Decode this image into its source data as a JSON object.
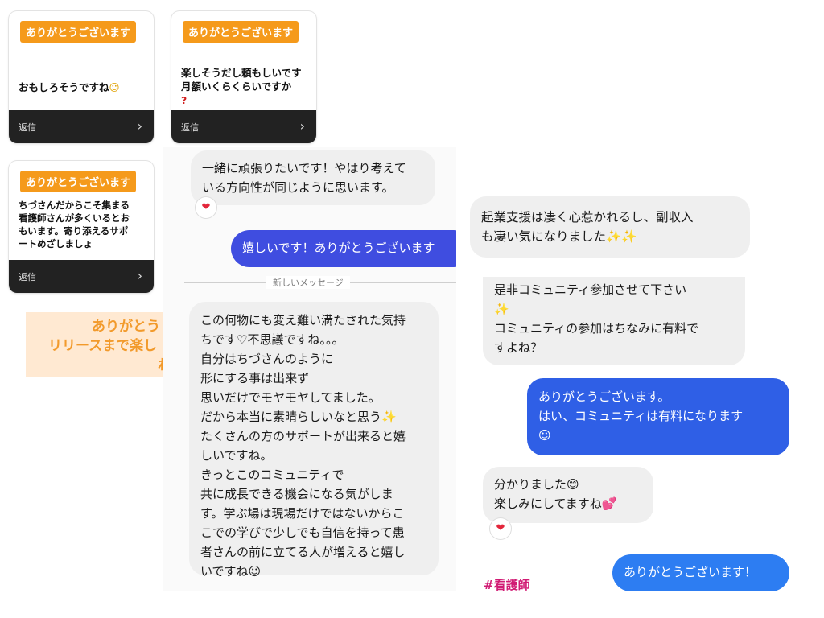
{
  "cards": [
    {
      "tag": "ありがとうございます",
      "lines": [
        "おもしろそうですね"
      ],
      "emoji": "☺",
      "reply_label": "返信"
    },
    {
      "tag": "ありがとうございます",
      "lines": [
        "楽しそうだし頼もしいです",
        "月額いくらくらいですか"
      ],
      "emoji": "?",
      "reply_label": "返信"
    },
    {
      "tag": "ありがとうございます",
      "lines": [
        "ちづさんだからこそ集まる",
        "看護師さんが多くいるとお",
        "もいます。寄り添えるサポ",
        "ートめざしましょ"
      ],
      "reply_label": "返信"
    }
  ],
  "banner": {
    "lines": [
      "ありがとう",
      "リリースまで楽し",
      "れ"
    ]
  },
  "chat_left": {
    "msg1": [
      "一緒に頑張りたいです！やはり考えて",
      "いる方向性が同じように思います。"
    ],
    "reaction": "❤",
    "msg2": "嬉しいです！ありがとうございます",
    "new_messages_label": "新しいメッセージ",
    "msg3": [
      "この何物にも変え難い満たされた気持",
      "ちです♡不思議ですね。。。",
      "自分はちづさんのように",
      "形にする事は出来ず",
      "思いだけでモヤモヤしてました。",
      "だから本当に素晴らしいなと思う✨",
      "たくさんの方のサポートが出来ると嬉",
      "しいですね。",
      "きっとこのコミュニティで",
      "共に成長できる機会になる気がしま",
      "す。学ぶ場は現場だけではないからこ",
      "こでの学びで少しでも自信を持って患",
      "者さんの前に立てる人が増えると嬉し",
      "いですね☺"
    ]
  },
  "chat_right_top": {
    "msg": [
      "起業支援は凄く心惹かれるし、副収入",
      "も凄い気になりました✨✨"
    ]
  },
  "chat_right": {
    "msg1": [
      "是非コミュニティ参加させて下さい",
      "✨",
      "コミュニティの参加はちなみに有料で",
      "すよね？"
    ],
    "msg2": [
      "ありがとうございます。",
      "はい、コミュニティは有料になります",
      "☺"
    ],
    "msg3": [
      "分かりました😊",
      "楽しみにしてますね💕"
    ],
    "reaction": "❤",
    "msg4": "ありがとうございます！",
    "hashtag": "#看護師"
  },
  "colors": {
    "tag_orange": "#f59a1b",
    "bubble_out": "#3f4de0",
    "hashtag": "#d11b74"
  }
}
